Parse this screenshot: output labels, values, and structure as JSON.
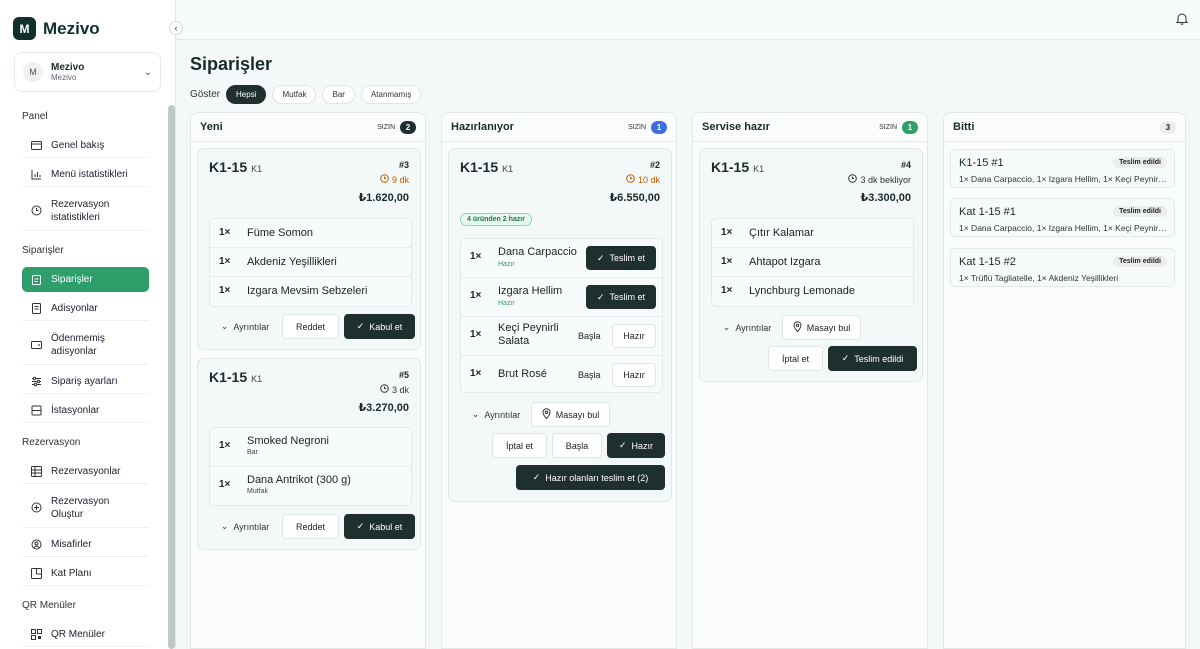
{
  "app": {
    "logo_letter": "M",
    "name": "Mezivo"
  },
  "org": {
    "avatar": "M",
    "name": "Mezivo",
    "sub": "Mezivo"
  },
  "sidebar": {
    "sections": [
      {
        "label": "Panel",
        "items": [
          {
            "label": "Genel bakış",
            "icon": "dashboard-icon"
          },
          {
            "label": "Menü istatistikleri",
            "icon": "bar-chart-icon"
          },
          {
            "label": "Rezervasyon istatistikleri",
            "icon": "clock-icon"
          }
        ]
      },
      {
        "label": "Siparişler",
        "items": [
          {
            "label": "Siparişler",
            "icon": "clipboard-icon",
            "active": true
          },
          {
            "label": "Adisyonlar",
            "icon": "receipt-icon"
          },
          {
            "label": "Ödenmemiş adisyonlar",
            "icon": "wallet-icon"
          },
          {
            "label": "Sipariş ayarları",
            "icon": "sliders-icon"
          },
          {
            "label": "İstasyonlar",
            "icon": "station-icon"
          }
        ]
      },
      {
        "label": "Rezervasyon",
        "items": [
          {
            "label": "Rezervasyonlar",
            "icon": "table-icon"
          },
          {
            "label": "Rezervasyon Oluştur",
            "icon": "plus-circle-icon"
          },
          {
            "label": "Misafirler",
            "icon": "user-circle-icon"
          },
          {
            "label": "Kat Planı",
            "icon": "floor-plan-icon"
          }
        ]
      },
      {
        "label": "QR Menüler",
        "items": [
          {
            "label": "QR Menüler",
            "icon": "qr-icon"
          }
        ]
      }
    ]
  },
  "page": {
    "title": "Siparişler",
    "filter_label": "Göster",
    "filters": [
      "Hepsi",
      "Mutfak",
      "Bar",
      "Atanmamış"
    ],
    "active_filter": "Hepsi"
  },
  "colors": {
    "accent": "#2e9e6a",
    "dark": "#1f2f2d",
    "orange": "#c75a00",
    "blue": "#3b6fe0"
  },
  "columns": {
    "yeni": {
      "title": "Yeni",
      "mine_label": "SIZIN",
      "count": "2",
      "orders": [
        {
          "table": "K1-15",
          "area": "K1",
          "number": "#3",
          "elapsed": "9 dk",
          "total": "₺1.620,00",
          "items": [
            {
              "qty": "1×",
              "name": "Füme Somon"
            },
            {
              "qty": "1×",
              "name": "Akdeniz Yeşillikleri"
            },
            {
              "qty": "1×",
              "name": "Izgara Mevsim Sebzeleri"
            }
          ],
          "details": "Ayrıntılar",
          "reject": "Reddet",
          "accept": "Kabul et"
        },
        {
          "table": "K1-15",
          "area": "K1",
          "number": "#5",
          "elapsed": "3 dk",
          "total": "₺3.270,00",
          "items": [
            {
              "qty": "1×",
              "name": "Smoked Negroni",
              "station": "Bar"
            },
            {
              "qty": "1×",
              "name": "Dana Antrikot (300 g)",
              "station": "Mutfak"
            }
          ],
          "details": "Ayrıntılar",
          "reject": "Reddet",
          "accept": "Kabul et"
        }
      ]
    },
    "hazirlaniyor": {
      "title": "Hazırlanıyor",
      "mine_label": "SIZIN",
      "count": "1",
      "order": {
        "table": "K1-15",
        "area": "K1",
        "number": "#2",
        "elapsed": "10 dk",
        "total": "₺6.550,00",
        "ready_badge": "4 üründen 2 hazır",
        "items": [
          {
            "qty": "1×",
            "name": "Dana Carpaccio",
            "status": "Hazır",
            "action": "Teslim et"
          },
          {
            "qty": "1×",
            "name": "Izgara Hellim",
            "status": "Hazır",
            "action": "Teslim et"
          },
          {
            "qty": "1×",
            "name": "Keçi Peynirli Salata",
            "start": "Başla",
            "ready": "Hazır"
          },
          {
            "qty": "1×",
            "name": "Brut Rosé",
            "start": "Başla",
            "ready": "Hazır"
          }
        ],
        "details": "Ayrıntılar",
        "find_table": "Masayı bul",
        "cancel": "İptal et",
        "start": "Başla",
        "ready": "Hazır",
        "deliver_ready": "Hazır olanları teslim et (2)"
      }
    },
    "servise_hazir": {
      "title": "Servise hazır",
      "mine_label": "SIZIN",
      "count": "1",
      "order": {
        "table": "K1-15",
        "area": "K1",
        "number": "#4",
        "waiting": "3 dk bekliyor",
        "total": "₺3.300,00",
        "items": [
          {
            "qty": "1×",
            "name": "Çıtır Kalamar"
          },
          {
            "qty": "1×",
            "name": "Ahtapot Izgara"
          },
          {
            "qty": "1×",
            "name": "Lynchburg Lemonade"
          }
        ],
        "details": "Ayrıntılar",
        "find_table": "Masayı bul",
        "cancel": "İptal et",
        "delivered": "Teslim edildi"
      }
    },
    "bitti": {
      "title": "Bitti",
      "count": "3",
      "orders": [
        {
          "table": "K1-15",
          "number": "#1",
          "status": "Teslim edildi",
          "summary": "1× Dana Carpaccio, 1× Izgara Hellim, 1× Keçi Peynirli Salata"
        },
        {
          "table": "Kat 1-15",
          "number": "#1",
          "status": "Teslim edildi",
          "summary": "1× Dana Carpaccio, 1× Izgara Hellim, 1× Keçi Peynirli Salata"
        },
        {
          "table": "Kat 1-15",
          "number": "#2",
          "status": "Teslim edildi",
          "summary": "1× Trüflü Tagliatelle, 1× Akdeniz Yeşillikleri"
        }
      ]
    }
  }
}
